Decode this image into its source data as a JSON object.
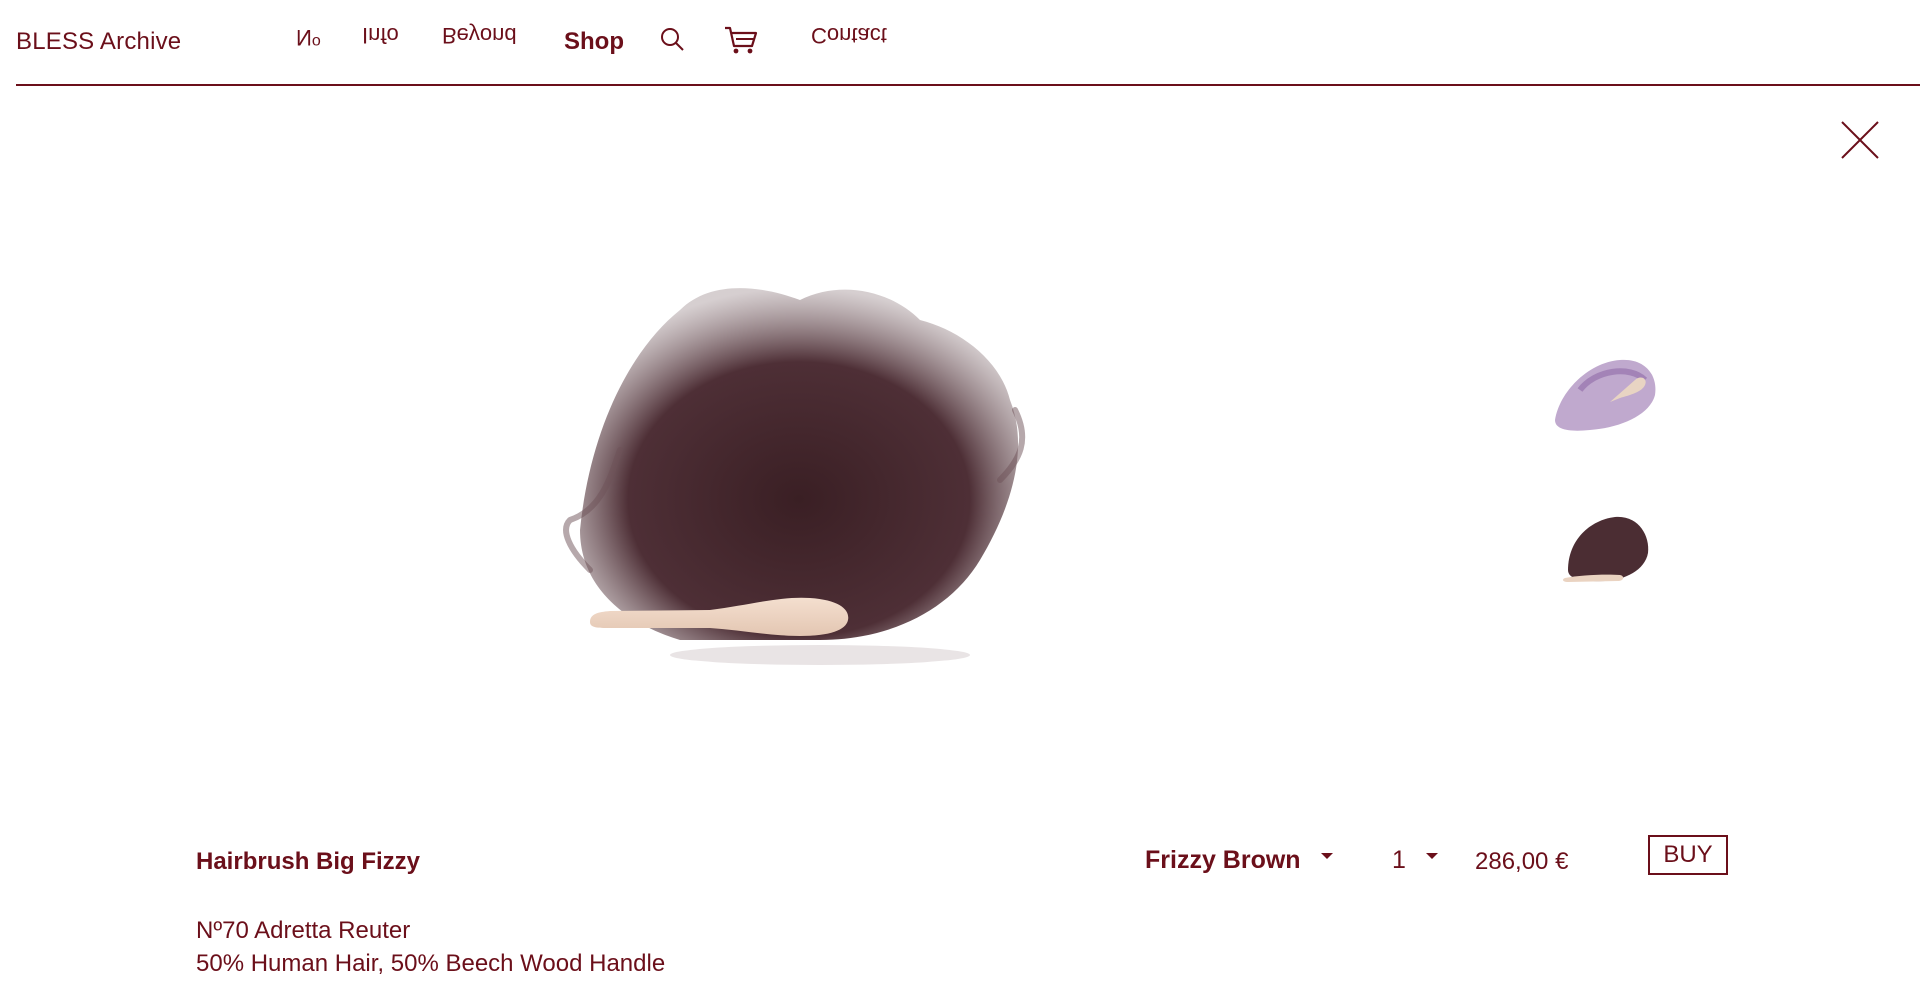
{
  "header": {
    "brand": "BLESS Archive",
    "nav": {
      "no": "No",
      "info": "Info",
      "beyond": "Beyond",
      "shop": "Shop",
      "contact": "Contact"
    },
    "icons": [
      "search-icon",
      "cart-icon",
      "close-icon"
    ]
  },
  "product": {
    "title": "Hairbrush Big Fizzy",
    "subtitle": "Nº70 Adretta Reuter",
    "material": "50% Human Hair, 50% Beech Wood Handle",
    "variant": "Frizzy Brown",
    "quantity": "1",
    "price": "286,00 €",
    "buy_label": "BUY"
  },
  "colors": {
    "accent": "#6b0f1a",
    "background": "#ffffff"
  }
}
